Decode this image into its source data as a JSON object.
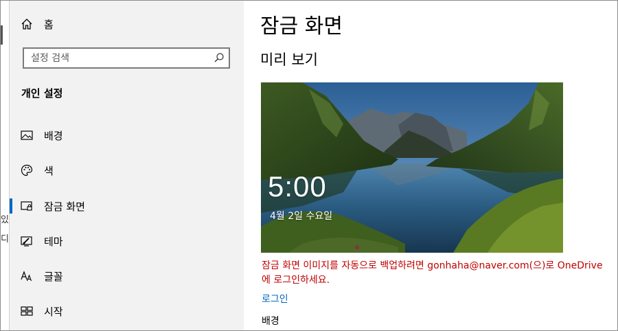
{
  "left_strip": {
    "glyphs": [
      "있",
      "디"
    ]
  },
  "sidebar": {
    "home_label": "홈",
    "search_placeholder": "설정 검색",
    "section_title": "개인 설정",
    "items": [
      {
        "label": "배경",
        "icon": "picture-icon"
      },
      {
        "label": "색",
        "icon": "palette-icon"
      },
      {
        "label": "잠금 화면",
        "icon": "lock-screen-icon",
        "active": true
      },
      {
        "label": "테마",
        "icon": "theme-icon"
      },
      {
        "label": "글꼴",
        "icon": "font-icon"
      },
      {
        "label": "시작",
        "icon": "start-icon"
      }
    ]
  },
  "main": {
    "title": "잠금 화면",
    "preview_heading": "미리 보기",
    "preview": {
      "time": "5:00",
      "date": "4월 2일 수요일"
    },
    "warning": "잠금 화면 이미지를 자동으로 백업하려면 gonhaha@naver.com(으)로 OneDrive에 로그인하세요.",
    "signin_link": "로그인",
    "background_label": "배경"
  },
  "colors": {
    "accent": "#0067c0",
    "warning": "#c00000",
    "sidebar_bg": "#f2f2f2"
  }
}
